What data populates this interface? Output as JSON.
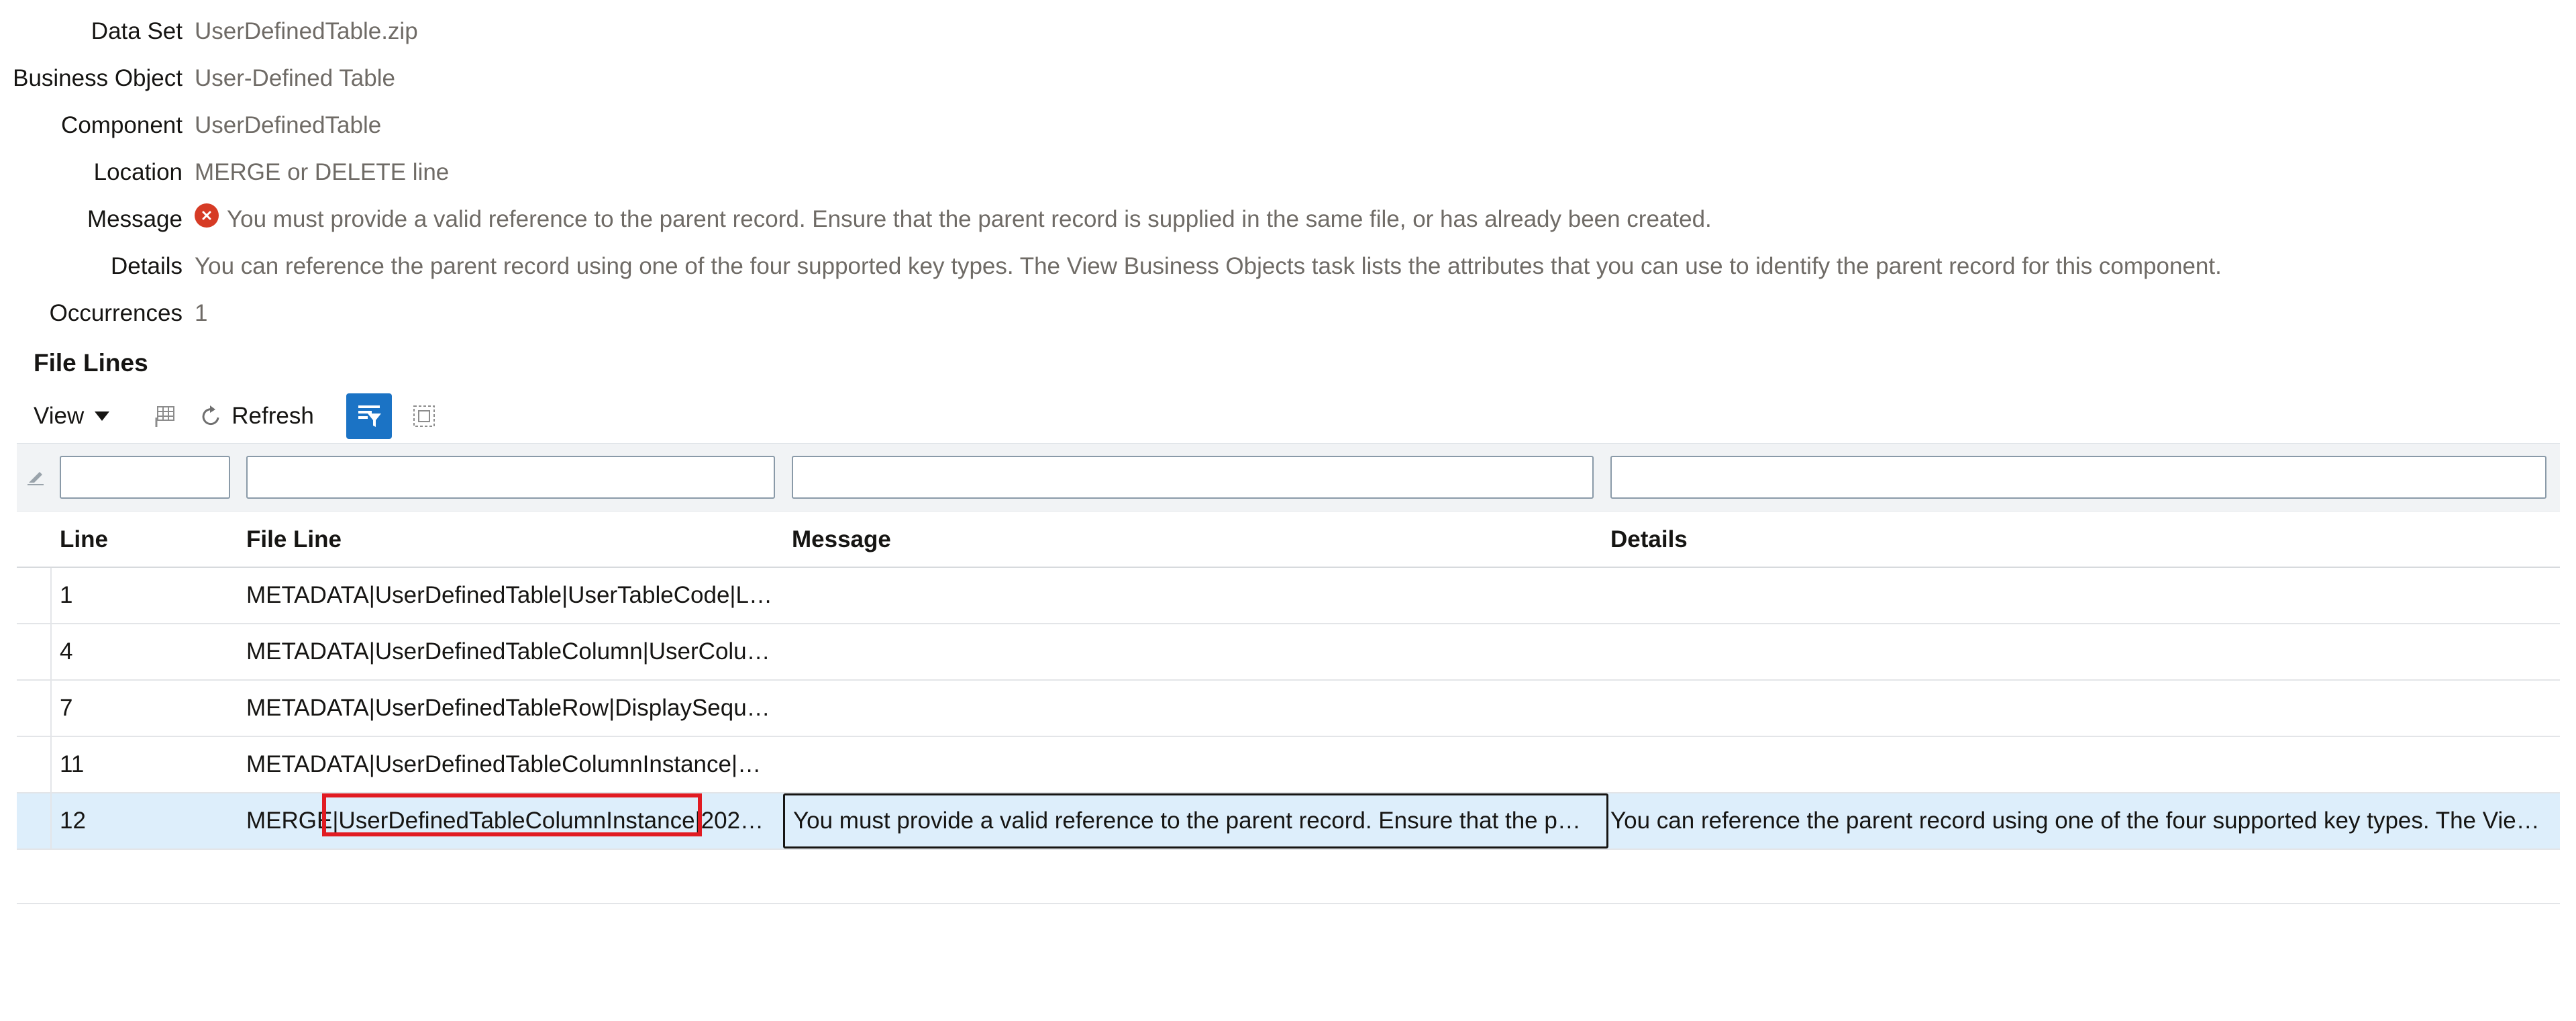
{
  "details": {
    "data_set": {
      "label": "Data Set",
      "value": "UserDefinedTable.zip"
    },
    "business_object": {
      "label": "Business Object",
      "value": "User-Defined Table"
    },
    "component": {
      "label": "Component",
      "value": "UserDefinedTable"
    },
    "location": {
      "label": "Location",
      "value": "MERGE or DELETE line"
    },
    "message": {
      "label": "Message",
      "value": "You must provide a valid reference to the parent record. Ensure that the parent record is supplied in the same file, or has already been created."
    },
    "details": {
      "label": "Details",
      "value": "You can reference the parent record using one of the four supported key types. The View Business Objects task lists the attributes that you can use to identify the parent record for this component."
    },
    "occurrences": {
      "label": "Occurrences",
      "value": "1"
    }
  },
  "file_lines": {
    "title": "File Lines",
    "toolbar": {
      "view_label": "View",
      "refresh_label": "Refresh"
    },
    "columns": {
      "line": "Line",
      "file_line": "File Line",
      "message": "Message",
      "details": "Details"
    },
    "rows": [
      {
        "line": "1",
        "file_line": "METADATA|UserDefinedTable|UserTableCode|L…",
        "message": "",
        "details": ""
      },
      {
        "line": "4",
        "file_line": "METADATA|UserDefinedTableColumn|UserColu…",
        "message": "",
        "details": ""
      },
      {
        "line": "7",
        "file_line": "METADATA|UserDefinedTableRow|DisplaySequ…",
        "message": "",
        "details": ""
      },
      {
        "line": "11",
        "file_line": "METADATA|UserDefinedTableColumnInstance|…",
        "message": "",
        "details": ""
      },
      {
        "line": "12",
        "file_line": "MERGE|UserDefinedTableColumnInstance|202…",
        "message": "You must provide a valid reference to the parent record. Ensure that the p…",
        "details": "You can reference the parent record using one of the four supported key types. The Vie…"
      }
    ]
  },
  "colors": {
    "accent": "#1b73c5",
    "error": "#d63b25",
    "selected_row": "#ddeefb",
    "highlight": "#e11b22"
  }
}
